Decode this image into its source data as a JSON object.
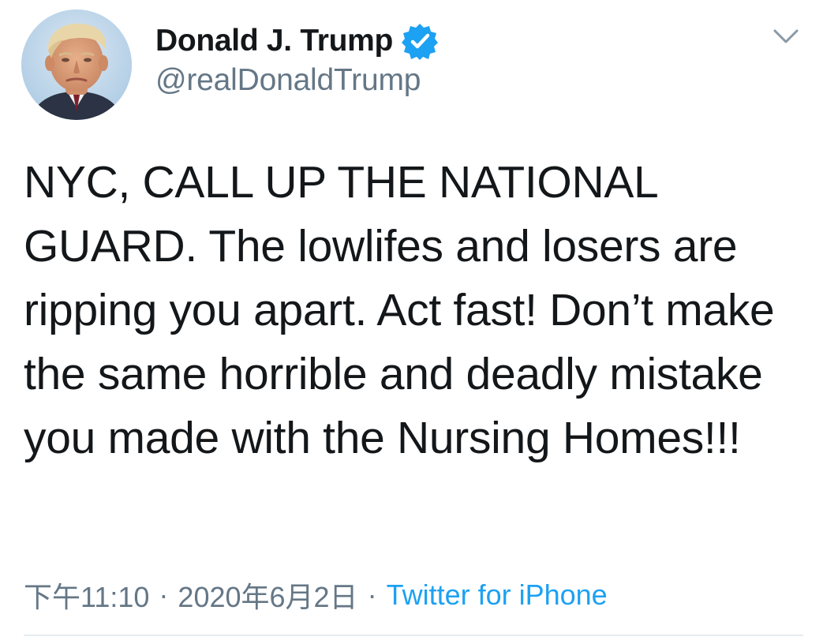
{
  "tweet": {
    "author": {
      "display_name": "Donald J. Trump",
      "handle": "@realDonaldTrump",
      "verified": true,
      "avatar_icon": "profile-photo"
    },
    "text": "NYC, CALL UP THE NATIONAL GUARD. The lowlifes and losers are ripping you apart. Act fast! Don’t make the same horrible and deadly mistake you made with the Nursing Homes!!!",
    "meta": {
      "time": "下午11:10",
      "separator": "·",
      "date": "2020年6月2日",
      "source": "Twitter for iPhone"
    },
    "menu_icon": "chevron-down-icon"
  },
  "colors": {
    "text_primary": "#14171a",
    "text_secondary": "#657786",
    "accent_blue": "#1da1f2",
    "divider": "#e6ecf0",
    "background": "#ffffff"
  }
}
